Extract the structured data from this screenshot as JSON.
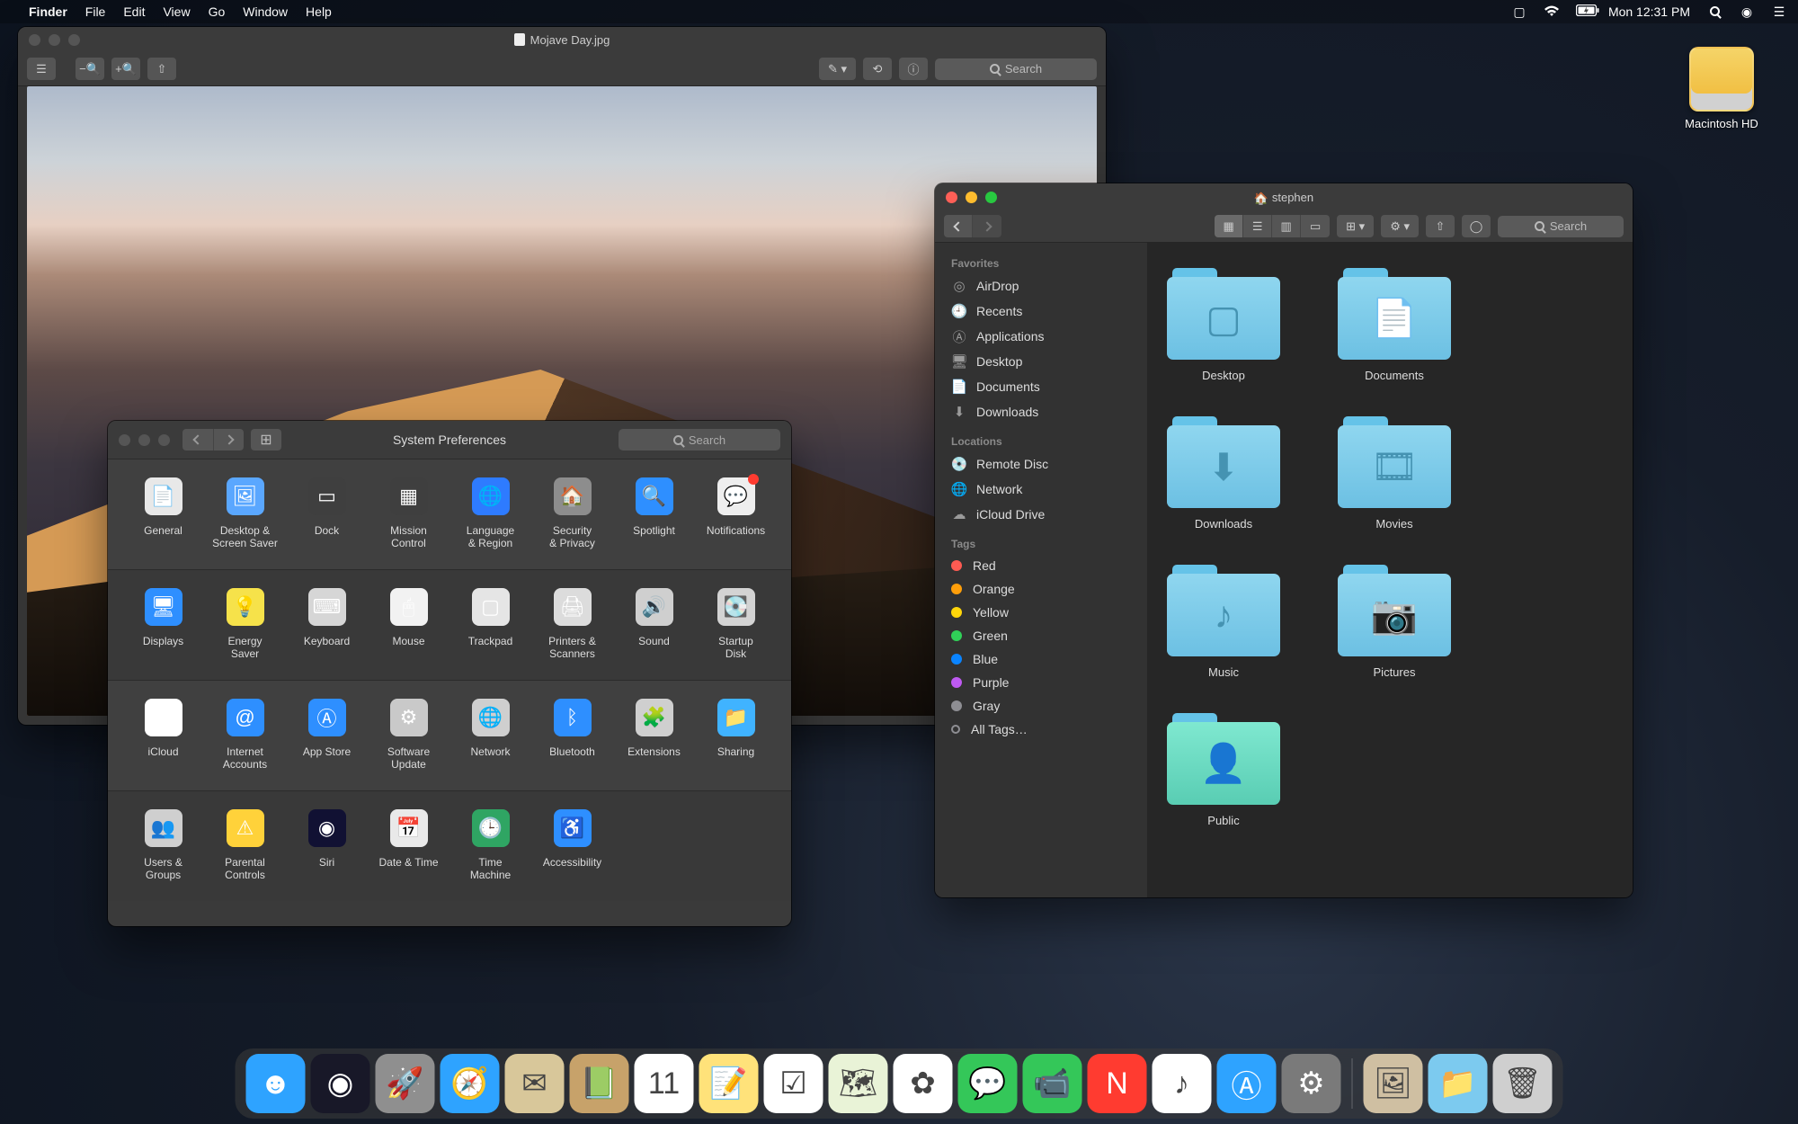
{
  "menubar": {
    "app": "Finder",
    "items": [
      "File",
      "Edit",
      "View",
      "Go",
      "Window",
      "Help"
    ],
    "clock": "Mon 12:31 PM"
  },
  "desktop": {
    "hd_label": "Macintosh HD"
  },
  "preview": {
    "title": "Mojave Day.jpg",
    "search_placeholder": "Search"
  },
  "sysprefs": {
    "title": "System Preferences",
    "search_placeholder": "Search",
    "rows": [
      [
        "General",
        "Desktop &\nScreen Saver",
        "Dock",
        "Mission\nControl",
        "Language\n& Region",
        "Security\n& Privacy",
        "Spotlight",
        "Notifications"
      ],
      [
        "Displays",
        "Energy\nSaver",
        "Keyboard",
        "Mouse",
        "Trackpad",
        "Printers &\nScanners",
        "Sound",
        "Startup\nDisk"
      ],
      [
        "iCloud",
        "Internet\nAccounts",
        "App Store",
        "Software\nUpdate",
        "Network",
        "Bluetooth",
        "Extensions",
        "Sharing"
      ],
      [
        "Users &\nGroups",
        "Parental\nControls",
        "Siri",
        "Date & Time",
        "Time\nMachine",
        "Accessibility"
      ]
    ],
    "row_colors": [
      [
        "#e8e8e8",
        "#5aa7ff",
        "#3f3f3f",
        "#3f3f3f",
        "#2e7bff",
        "#8d8d8d",
        "#2e8fff",
        "#eeeeee"
      ],
      [
        "#2e8fff",
        "#f6e24a",
        "#d6d6d6",
        "#f2f2f2",
        "#e5e5e5",
        "#dcdcdc",
        "#cfcfcf",
        "#d3d3d3"
      ],
      [
        "#ffffff",
        "#2e8fff",
        "#2e8fff",
        "#c9c9c9",
        "#cfcfcf",
        "#2e8fff",
        "#cfcfcf",
        "#40b3ff"
      ],
      [
        "#cfcfcf",
        "#ffd23a",
        "#111133",
        "#e9e9e9",
        "#2fa563",
        "#2e8fff"
      ]
    ],
    "row_glyphs": [
      [
        "📄",
        "🖼",
        "▭",
        "▦",
        "🌐",
        "🏠",
        "🔍",
        "💬"
      ],
      [
        "🖥",
        "💡",
        "⌨",
        "🖱",
        "▢",
        "🖨",
        "🔊",
        "💽"
      ],
      [
        "☁",
        "@",
        "Ⓐ",
        "⚙",
        "🌐",
        "ᛒ",
        "🧩",
        "📁"
      ],
      [
        "👥",
        "⚠",
        "◉",
        "📅",
        "🕒",
        "♿"
      ]
    ]
  },
  "finder": {
    "title": "stephen",
    "search_placeholder": "Search",
    "sidebar": {
      "favorites_label": "Favorites",
      "favorites": [
        "AirDrop",
        "Recents",
        "Applications",
        "Desktop",
        "Documents",
        "Downloads"
      ],
      "favorites_icons": [
        "◎",
        "🕘",
        "Ⓐ",
        "🖥",
        "📄",
        "⬇"
      ],
      "locations_label": "Locations",
      "locations": [
        "Remote Disc",
        "Network",
        "iCloud Drive"
      ],
      "locations_icons": [
        "💿",
        "🌐",
        "☁"
      ],
      "tags_label": "Tags",
      "tags": [
        "Red",
        "Orange",
        "Yellow",
        "Green",
        "Blue",
        "Purple",
        "Gray",
        "All Tags…"
      ],
      "tag_colors": [
        "#ff5b52",
        "#ff9f0a",
        "#ffd60a",
        "#30d158",
        "#0a84ff",
        "#bf5af2",
        "#8e8e93",
        "#8e8e93"
      ]
    },
    "folders": [
      "Desktop",
      "Documents",
      "Downloads",
      "Movies",
      "Music",
      "Pictures",
      "Public"
    ],
    "folder_glyphs": [
      "▢",
      "📄",
      "⬇",
      "🎞",
      "♪",
      "📷",
      "👤"
    ]
  },
  "dock": {
    "items": [
      "Finder",
      "Siri",
      "Launchpad",
      "Safari",
      "Mail",
      "Contacts",
      "Calendar",
      "Notes",
      "Reminders",
      "Maps",
      "Photos",
      "Messages",
      "FaceTime",
      "News",
      "iTunes",
      "App Store",
      "System Preferences"
    ],
    "colors": [
      "#2ea3ff",
      "#181828",
      "#8f8f8f",
      "#2ea3ff",
      "#d8c79a",
      "#c7a26a",
      "#ffffff",
      "#ffe27a",
      "#ffffff",
      "#e9f3d7",
      "#ffffff",
      "#34c759",
      "#34c759",
      "#ff3b30",
      "#ffffff",
      "#2ea3ff",
      "#7a7a7a"
    ],
    "glyphs": [
      "☻",
      "◉",
      "🚀",
      "🧭",
      "✉",
      "📗",
      "11",
      "📝",
      "☑",
      "🗺",
      "✿",
      "💬",
      "📹",
      "N",
      "♪",
      "Ⓐ",
      "⚙"
    ],
    "right": [
      "Desktop-mini",
      "Downloads",
      "Trash"
    ],
    "right_glyphs": [
      "🖼",
      "📁",
      "🗑"
    ]
  }
}
